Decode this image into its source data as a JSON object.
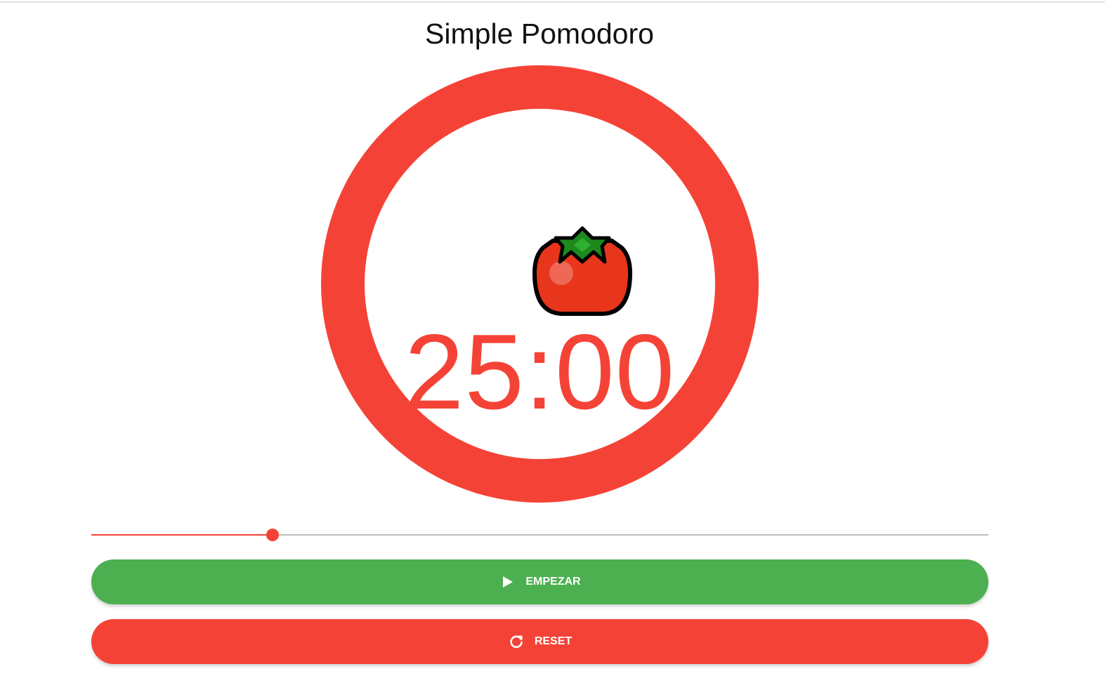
{
  "app": {
    "title": "Simple Pomodoro"
  },
  "timer": {
    "display": "25:00",
    "icon": "tomato-icon",
    "ring_color": "#f44336"
  },
  "slider": {
    "value_fraction": 0.202,
    "fill_color": "#f44336",
    "track_color": "#bdbdbd"
  },
  "buttons": {
    "start": {
      "label": "EMPEZAR",
      "icon": "play-icon",
      "color": "#4caf50"
    },
    "reset": {
      "label": "RESET",
      "icon": "refresh-icon",
      "color": "#f44336"
    }
  }
}
